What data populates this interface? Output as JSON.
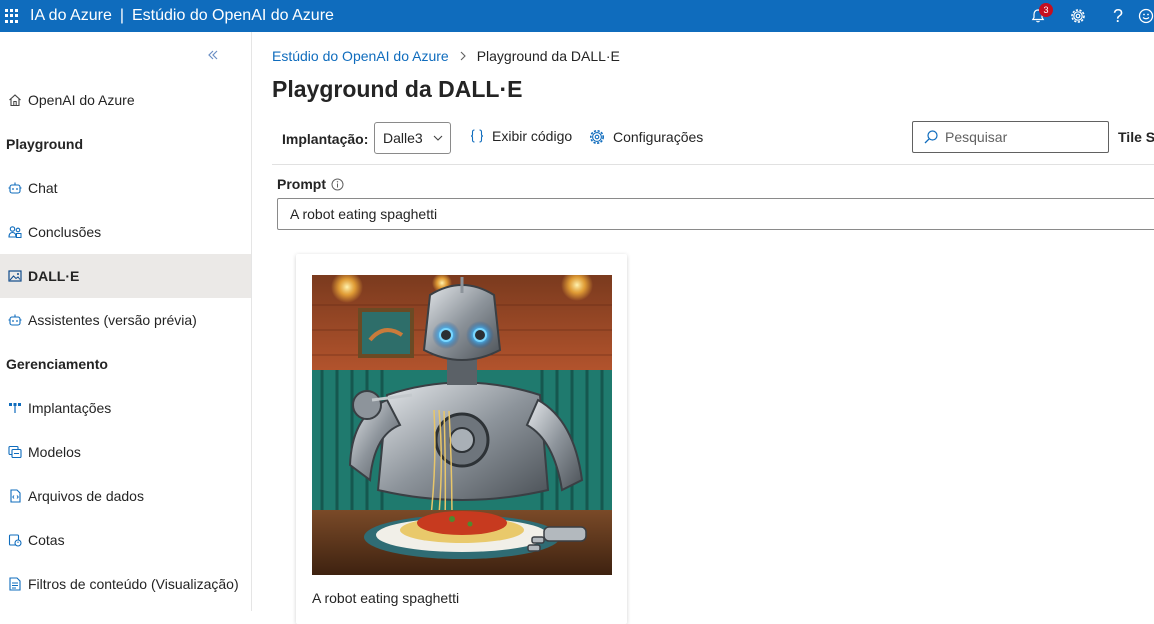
{
  "topbar": {
    "product": "IA do Azure",
    "separator": "|",
    "studio": "Estúdio do OpenAI do Azure",
    "notification_count": "3",
    "help_glyph": "?"
  },
  "sidebar": {
    "items": [
      {
        "label": "OpenAI do Azure",
        "icon": "home-icon"
      },
      {
        "label": "Chat",
        "icon": "bot-icon"
      },
      {
        "label": "Conclusões",
        "icon": "people-icon"
      },
      {
        "label": "DALL·E",
        "icon": "image-icon"
      },
      {
        "label": "Assistentes (versão prévia)",
        "icon": "bot-icon"
      },
      {
        "label": "Implantações",
        "icon": "deployment-icon"
      },
      {
        "label": "Modelos",
        "icon": "models-icon"
      },
      {
        "label": "Arquivos de dados",
        "icon": "data-file-icon"
      },
      {
        "label": "Cotas",
        "icon": "quota-icon"
      },
      {
        "label": "Filtros de conteúdo (Visualização)",
        "icon": "content-filter-icon"
      }
    ],
    "headings": {
      "playground": "Playground",
      "management": "Gerenciamento"
    }
  },
  "breadcrumb": {
    "parent": "Estúdio do OpenAI do Azure",
    "current": "Playground da DALL·E"
  },
  "page": {
    "title": "Playground da DALL·E"
  },
  "toolbar": {
    "deploy_label": "Implantação:",
    "deploy_value": "Dalle3",
    "view_code": "Exibir código",
    "settings": "Configurações",
    "search_placeholder": "Pesquisar",
    "tile_size": "Tile Si"
  },
  "prompt": {
    "label": "Prompt",
    "value": "A robot eating spaghetti"
  },
  "result": {
    "caption": "A robot eating spaghetti"
  },
  "colors": {
    "accent": "#0f6cbd",
    "active_nav": "#ebe9e7",
    "badge": "#c50f1f"
  }
}
